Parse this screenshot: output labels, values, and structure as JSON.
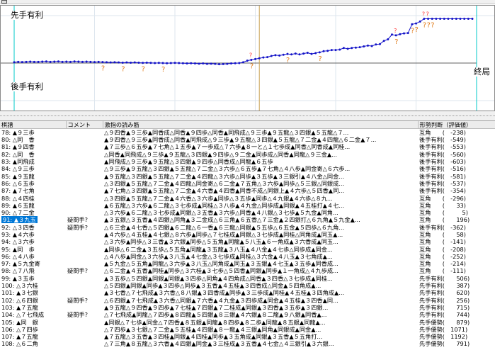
{
  "graph": {
    "label_top": "先手有利",
    "label_bottom": "後手有利",
    "label_end": "終局",
    "colors": {
      "grid": "#00c8c8",
      "line": "#1414c8",
      "question": "#e07a18",
      "marker": "#ff3030",
      "cursor": "#c8a050"
    },
    "total_moves": 114,
    "current_move": 91,
    "scale_max": 1200,
    "evals": [
      20,
      30,
      25,
      30,
      35,
      30,
      30,
      35,
      40,
      30,
      35,
      40,
      30,
      35,
      30,
      40,
      35,
      30,
      35,
      30,
      25,
      30,
      25,
      20,
      15,
      20,
      15,
      10,
      15,
      10,
      15,
      10,
      5,
      10,
      5,
      0,
      5,
      0,
      -5,
      0,
      5,
      0,
      -5,
      -10,
      -5,
      -10,
      -15,
      -10,
      -20,
      -15,
      -20,
      -30,
      -25,
      -20,
      -10,
      -5,
      0,
      20,
      60,
      80,
      100,
      120,
      140,
      150,
      180,
      200,
      190,
      210,
      230,
      220,
      240,
      220,
      240,
      260,
      230,
      250,
      270,
      300,
      310,
      330,
      330,
      340,
      380,
      360,
      380,
      390,
      400,
      420,
      440,
      430,
      470,
      480,
      560,
      600,
      720,
      700,
      730,
      750,
      760,
      980,
      1000,
      1050,
      1120,
      1120,
      1120,
      1120,
      1120,
      1120,
      1120,
      1120,
      1120,
      1120,
      1120,
      1120,
      1120
    ],
    "questions": [
      22,
      27,
      32,
      37,
      59,
      68,
      76,
      95,
      99,
      100,
      102,
      103,
      104
    ],
    "marks": [
      59,
      95,
      102,
      103
    ]
  },
  "table": {
    "headers": [
      "棋譜",
      "コメント",
      "激指の読み筋",
      "形勢判断（評価値）"
    ],
    "rows": [
      {
        "move": "78: ▲９三歩",
        "comment": "",
        "line": "△９四香▲９三歩▲同香成△同香▲９四歩△同香▲同飛成△９三歩▲９五龍△３四銀▲５五龍△７...",
        "eval": "互角　　(　-238)"
      },
      {
        "move": "80: △同　香",
        "comment": "",
        "line": "▲９四香△９三歩▲同香成△同香▲同飛成△９三歩▲９五龍△３四銀▲５五龍△７二金▲４四龍△６二金▲７...",
        "eval": "後手有利(　-549)"
      },
      {
        "move": "81: ▲９四香",
        "comment": "",
        "line": "▲７三歩△６五歩▲７七角△１五歩▲７一歩成△７六歩▲８一と△１七歩成▲同香△同香成▲同桂...",
        "eval": "後手有利(　-553)"
      },
      {
        "move": "82: △同　香",
        "comment": "",
        "line": "△同香▲同飛成△９三歩▲９五龍△３四銀▲９四歩△９二金▲同歩成△同香▲同龍△９三金▲...",
        "eval": "後手有利(　-560)"
      },
      {
        "move": "83: ▲同飛成",
        "comment": "",
        "line": "▲同飛成△９三歩▲９五龍△３四銀▲９四歩△同香成△同龍▲６五歩",
        "eval": "後手有利(　-603)"
      },
      {
        "move": "84: △９三歩",
        "comment": "",
        "line": "△９三歩▲９五龍△３四銀▲５五龍△７二金△３六歩△６五歩▲７七角△４八歩▲同金寄△６六歩...",
        "eval": "後手有利(　-516)"
      },
      {
        "move": "85: ▲９五龍",
        "comment": "",
        "line": "▲９五龍△３四銀▲５五龍△７二金▲４四龍△３六歩△同歩▲３五歩▲３三銀引▲４八金△同金...",
        "eval": "後手有利(　-581)"
      },
      {
        "move": "86: △６五歩",
        "comment": "",
        "line": "△３四銀▲５五龍△７二金▲４四龍△同金寄△６二金▲７五角△３六歩▲同歩△５三銀△同銀成...",
        "eval": "後手有利(　-537)"
      },
      {
        "move": "87: ▲７七角",
        "comment": "",
        "line": "▲７七角△３四銀▲５五龍△７二金▲４六香▲４四香▲同香不成△同銀上▲４六歩△５四香▲同...",
        "eval": "後手有利(　-354)"
      },
      {
        "move": "88: △４四桂",
        "comment": "",
        "line": "△３四銀▲５五龍△７二金▲４六香△３六歩▲同歩△３五歩▲同歩△４九銀▲４六歩△８九...",
        "eval": "互角　　(　-296)"
      },
      {
        "move": "89: ▲６五龍",
        "comment": "",
        "line": "▲６五龍△３六歩▲６二龍△３七歩成▲同桂△３八歩▲４九金△同歩成▲同銀▲４五桂打▲４七...",
        "eval": "互角　　(　　33)"
      },
      {
        "move": "90: △７二金",
        "comment": "",
        "line": "△３六歩▲６二龍△３七歩成▲同銀△３五香▲３六歩△同香▲４八銀△３七歩▲５九金▲同角...",
        "eval": "互角　　(　　　5)"
      },
      {
        "move": "91: ▲３九玉",
        "comment": "疑問手?",
        "line": "▲３五銀△３五香▲４四銀△同角▲３二金成△６三角▲６五香△７三金▲２四銀打△６九角▲５九金▲...",
        "eval": "互角　　(　　196)",
        "selected": true
      },
      {
        "move": "92: △３四香",
        "comment": "疑問手?",
        "line": "△６三金▲４七香△５四銀▲６二龍△６一香▲６三龍△同銀▲５五歩△６五金▲５四歩△６九角...",
        "eval": "後手有利(　-362)"
      },
      {
        "move": "93: ▲４六歩",
        "comment": "",
        "line": "▲４六歩△４五桂▲４七銀△８六歩▲同歩△７七桂成▲同銀△３七歩成▲同桂△同角成▲同玉▲...",
        "eval": "互角　　(　　58)"
      },
      {
        "move": "94: △３六歩",
        "comment": "",
        "line": "△３六歩▲同歩△３三香▲３六銀▲同歩△５五角▲同龍▲５八玉▲６一角成▲３六香成▲同玉...",
        "eval": "互角　　(　-141)"
      },
      {
        "move": "95: ▲同　歩",
        "comment": "",
        "line": "▲同歩△６二金▲３五歩△５五角▲同龍▲３五龍▲３八玉▲４八金▲４七歩△同歩成▲同金...",
        "eval": "互角　　(　-208)"
      },
      {
        "move": "96: △４八歩",
        "comment": "",
        "line": "△４八歩▲同金△３六歩▲３八玉▲４七金△３七歩成▲同桂△３六金▲４八玉▲３七角成▲...",
        "eval": "互角　　(　-252)"
      },
      {
        "move": "97: ▲５九金寄",
        "comment": "",
        "line": "▲５九金△５五角▲同龍△３六歩▲３八玉△同角成▲同玉▲３五銀▲４七玉▲３五歩▲同香成...",
        "eval": "互角　　(　-214)"
      },
      {
        "move": "98: △７八飛",
        "comment": "疑問手?",
        "line": "△６二金▲４五香▲同桂▲同歩△３六桂▲３七歩△５四香▲同銀▲同歩▲１一角成△４九歩成...",
        "eval": "互角　　(　-111)"
      },
      {
        "move": "99: ▲３五歩",
        "comment": "",
        "line": "▲３五歩△５四銀▲同銀▲同銀▲３四歩△同角▲４四角成△同香▲３四香△３七歩成▲同桂...",
        "eval": "先手有利(　　506)"
      },
      {
        "move": "100: △３六桂",
        "comment": "",
        "line": "△５四銀▲同銀▲同歩▲３四歩△同歩▲３五香▲４五桂▲３四香成△同金▲５四角成▲...",
        "eval": "先手有利(　　387)"
      },
      {
        "move": "101: ▲３七銀",
        "comment": "",
        "line": "▲３七香△７七飛成▲３六香△８八銀▲３四香成▲同歩▲３三歩成▲同桂▲４五桂▲３四角成▲...",
        "eval": "先手有利(　　620)"
      },
      {
        "move": "102: △６四銀",
        "comment": "疑問手?",
        "line": "△６四銀▲７七飛成▲３六香△同銀▲７六香▲４九金▲３四歩成▲同金▲４五桂▲３四香▲同...",
        "eval": "先手有利(　　256)"
      },
      {
        "move": "103: ▲７五龍",
        "comment": "",
        "line": "▲９五龍△９四香▲９四歩▲７七桂▲７四銀▲７二桂成▲同銀▲３四香▲３五歩▲３四銀...",
        "eval": "先手有利(　　715)"
      },
      {
        "move": "104: △７七飛成",
        "comment": "疑問手?",
        "line": "△７七飛成▲同龍△７四歩▲８四龍▲５四銀▲８三銀▲４六銀▲８二龍▲９八銀▲同香▲...",
        "eval": "先手有利(　　744)"
      },
      {
        "move": "105: ▲同　銀",
        "comment": "",
        "line": "▲同銀△７七歩▲同金△７四香▲８五銀▲同龍▲８四歩▲８二歩▲同龍▲８五銀▲同龍▲...",
        "eval": "先手優勢(　　879)"
      },
      {
        "move": "106: △７四歩",
        "comment": "",
        "line": "△７四歩▲３七銀△７二金▲５五桂▲４四銀▲８一龍▲４三銀▲同角▲同銀成▲同金▲...",
        "eval": "先手優勢(　1071)"
      },
      {
        "move": "107: ▲７五龍",
        "comment": "",
        "line": "▲７五龍△３五香▲３四桂▲同銀▲４四桂▲同歩▲３五角成▲同銀▲３五香▲５五角打...",
        "eval": "先手優勢(　1192)"
      },
      {
        "move": "108: △６二角",
        "comment": "",
        "line": "△７三角▲８五龍△３六香▲４四銀▲同金▲３三桂成▲３五香▲４七金△４三銀引▲３六銀...",
        "eval": "先手優勢(　　791)"
      }
    ]
  }
}
